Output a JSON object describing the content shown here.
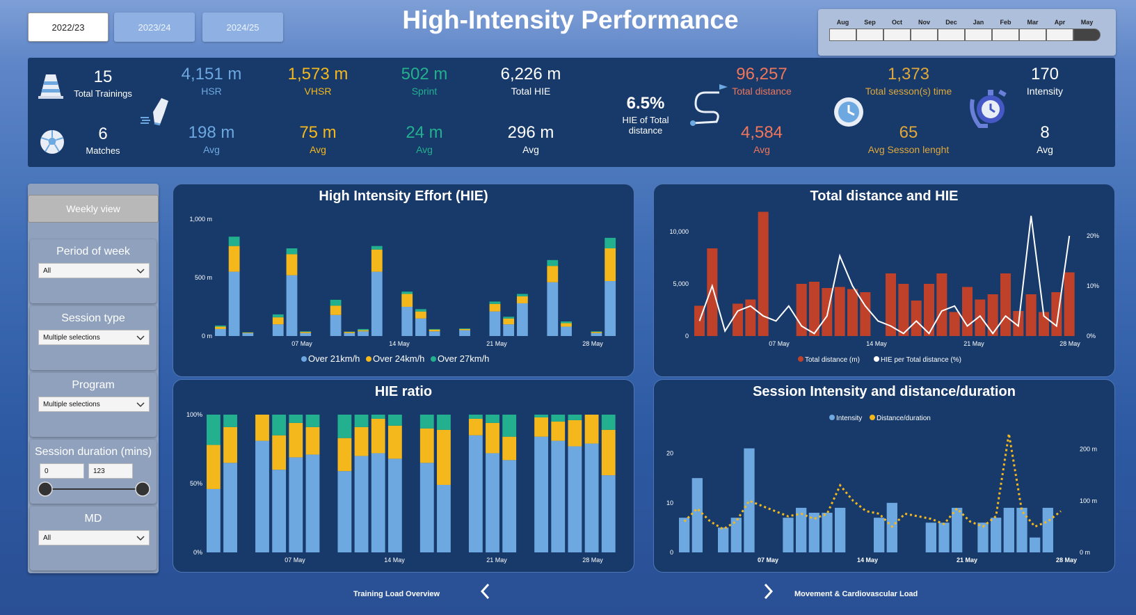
{
  "title": "High-Intensity Performance",
  "seasons": [
    "2022/23",
    "2023/24",
    "2024/25"
  ],
  "months": [
    "Aug",
    "Sep",
    "Oct",
    "Nov",
    "Dec",
    "Jan",
    "Feb",
    "Mar",
    "Apr",
    "May"
  ],
  "kpis": {
    "trainings": {
      "value": "15",
      "label": "Total Trainings"
    },
    "matches": {
      "value": "6",
      "label": "Matches"
    },
    "hsr": {
      "value": "4,151 m",
      "label": "HSR",
      "avg": "198 m",
      "avg_label": "Avg"
    },
    "vhsr": {
      "value": "1,573 m",
      "label": "VHSR",
      "avg": "75 m",
      "avg_label": "Avg"
    },
    "sprint": {
      "value": "502 m",
      "label": "Sprint",
      "avg": "24 m",
      "avg_label": "Avg"
    },
    "hie": {
      "value": "6,226 m",
      "label": "Total HIE",
      "avg": "296 m",
      "avg_label": "Avg"
    },
    "hie_pct": {
      "value": "6.5%",
      "label": "HIE of Total distance"
    },
    "distance": {
      "value": "96,257",
      "label": "Total distance",
      "avg": "4,584",
      "avg_label": "Avg"
    },
    "session_time": {
      "value": "1,373",
      "label": "Total sesson(s) time",
      "avg": "65",
      "avg_label": "Avg Sesson lenght"
    },
    "intensity": {
      "value": "170",
      "label": "Intensity",
      "avg": "8",
      "avg_label": "Avg"
    }
  },
  "sidebar": {
    "weekly_view": "Weekly view",
    "filters": [
      {
        "title": "Period of week",
        "value": "All"
      },
      {
        "title": "Session type",
        "value": "Multiple selections"
      },
      {
        "title": "Program",
        "value": "Multiple selections"
      },
      {
        "title": "Session duration (mins)",
        "min": "0",
        "max": "123"
      },
      {
        "title": "MD",
        "value": "All"
      }
    ]
  },
  "footer": {
    "prev": "Training Load Overview",
    "next": "Movement & Cardiovascular Load"
  },
  "colors": {
    "blue": "#6ea8e0",
    "yellow": "#f5b81c",
    "green": "#23b08e",
    "red": "#c0412a",
    "panel": "#173a6a"
  },
  "chart_data": [
    {
      "type": "bar",
      "title": "High Intensity Effort (HIE)",
      "stacked": true,
      "x_ticks": [
        "07 May",
        "14 May",
        "21 May",
        "28 May"
      ],
      "y_ticks": [
        "0 m",
        "500 m",
        "1,000 m"
      ],
      "ylim": [
        0,
        1000
      ],
      "legend": "bottom",
      "series": [
        {
          "name": "Over 21km/h",
          "values": [
            60,
            550,
            25,
            100,
            520,
            25,
            180,
            25,
            40,
            550,
            250,
            150,
            40,
            50,
            210,
            100,
            280,
            460,
            80,
            25,
            470
          ]
        },
        {
          "name": "Over 24km/h",
          "values": [
            20,
            220,
            5,
            60,
            180,
            10,
            80,
            10,
            10,
            190,
            110,
            60,
            15,
            10,
            65,
            50,
            60,
            140,
            30,
            10,
            280
          ]
        },
        {
          "name": "Over 27km/h",
          "values": [
            10,
            80,
            2,
            25,
            50,
            5,
            50,
            3,
            10,
            30,
            20,
            20,
            5,
            5,
            20,
            15,
            20,
            50,
            15,
            5,
            90
          ]
        }
      ]
    },
    {
      "type": "bar",
      "title": "HIE ratio",
      "stacked": true,
      "x_ticks": [
        "07 May",
        "14 May",
        "21 May",
        "28 May"
      ],
      "y_ticks": [
        "0%",
        "50%",
        "100%"
      ],
      "ylim": [
        0,
        100
      ],
      "series": [
        {
          "name": "Over 21km/h",
          "values": [
            46,
            65,
            81,
            60,
            69,
            71,
            59,
            70,
            72,
            68,
            65,
            49,
            85,
            72,
            67,
            84,
            81,
            77,
            79,
            56
          ]
        },
        {
          "name": "Over 24km/h",
          "values": [
            32,
            26,
            19,
            25,
            25,
            20,
            24,
            21,
            25,
            24,
            25,
            40,
            12,
            22,
            17,
            14,
            14,
            19,
            21,
            33
          ]
        },
        {
          "name": "Over 27km/h",
          "values": [
            22,
            9,
            0,
            15,
            6,
            9,
            17,
            9,
            3,
            8,
            10,
            11,
            3,
            6,
            16,
            2,
            5,
            4,
            0,
            11
          ]
        }
      ]
    },
    {
      "type": "bar+line",
      "title": "Total distance and HIE",
      "x_ticks": [
        "07 May",
        "14 May",
        "21 May",
        "28 May"
      ],
      "y_left_ticks": [
        "0",
        "5,000",
        "10,000"
      ],
      "ylim_left": [
        0,
        12000
      ],
      "y_right_ticks": [
        "0%",
        "10%",
        "20%"
      ],
      "ylim_right": [
        0,
        25
      ],
      "legend": "bottom",
      "series": [
        {
          "name": "Total distance (m)",
          "kind": "bar",
          "values": [
            2900,
            8400,
            3100,
            3500,
            11900,
            5000,
            5200,
            4600,
            4700,
            4500,
            4200,
            6000,
            5000,
            3400,
            5000,
            6000,
            2300,
            4700,
            3500,
            4000,
            6000,
            2400,
            4000,
            2300,
            4200,
            6100
          ]
        },
        {
          "name": "HIE per Total distance (%)",
          "kind": "line",
          "values": [
            3,
            10,
            1,
            5,
            6,
            4,
            3,
            6,
            2,
            0.5,
            4,
            16,
            10,
            6,
            3,
            2,
            0.5,
            3,
            0.5,
            5,
            6,
            2,
            4,
            0.5,
            4,
            2,
            24,
            4,
            2,
            20
          ]
        }
      ]
    },
    {
      "type": "bar+line",
      "title": "Session Intensity and distance/duration",
      "x_ticks": [
        "07 May",
        "14 May",
        "21 May",
        "28 May"
      ],
      "y_left_ticks": [
        "0",
        "10",
        "20"
      ],
      "ylim_left": [
        0,
        25
      ],
      "y_right_ticks": [
        "0 m",
        "100 m",
        "200 m"
      ],
      "ylim_right": [
        0,
        240
      ],
      "legend": "top",
      "series": [
        {
          "name": "Intensity",
          "kind": "bar",
          "values": [
            7,
            15,
            5,
            7,
            21,
            7,
            9,
            8,
            8,
            9,
            7,
            10,
            6,
            6,
            9,
            6,
            7,
            9,
            9,
            3,
            9
          ]
        },
        {
          "name": "Distance/duration",
          "kind": "line",
          "values": [
            60,
            85,
            60,
            45,
            60,
            100,
            90,
            80,
            70,
            75,
            65,
            75,
            130,
            100,
            80,
            75,
            50,
            75,
            70,
            65,
            55,
            85,
            60,
            50,
            70,
            230,
            80,
            50,
            60,
            80
          ]
        }
      ]
    }
  ]
}
